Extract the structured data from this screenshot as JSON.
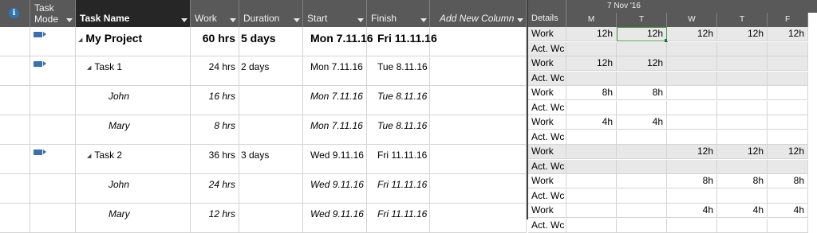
{
  "table": {
    "headers": {
      "info_icon_label": "i",
      "task_mode": "Task Mode",
      "task_name": "Task Name",
      "work": "Work",
      "duration": "Duration",
      "start": "Start",
      "finish": "Finish",
      "add_new_column": "Add New Column"
    },
    "rows": [
      {
        "name": "My Project",
        "work": "60 hrs",
        "duration": "5 days",
        "start": "Mon 7.11.16",
        "finish": "Fri 11.11.16",
        "style": "summary",
        "mode_icon": true
      },
      {
        "name": "Task 1",
        "work": "24 hrs",
        "duration": "2 days",
        "start": "Mon 7.11.16",
        "finish": "Tue 8.11.16",
        "style": "task",
        "mode_icon": true
      },
      {
        "name": "John",
        "work": "16 hrs",
        "duration": "",
        "start": "Mon 7.11.16",
        "finish": "Tue 8.11.16",
        "style": "assignment",
        "mode_icon": false
      },
      {
        "name": "Mary",
        "work": "8 hrs",
        "duration": "",
        "start": "Mon 7.11.16",
        "finish": "Tue 8.11.16",
        "style": "assignment",
        "mode_icon": false
      },
      {
        "name": "Task 2",
        "work": "36 hrs",
        "duration": "3 days",
        "start": "Wed 9.11.16",
        "finish": "Fri 11.11.16",
        "style": "task",
        "mode_icon": true
      },
      {
        "name": "John",
        "work": "24 hrs",
        "duration": "",
        "start": "Wed 9.11.16",
        "finish": "Fri 11.11.16",
        "style": "assignment",
        "mode_icon": false
      },
      {
        "name": "Mary",
        "work": "12 hrs",
        "duration": "",
        "start": "Wed 9.11.16",
        "finish": "Fri 11.11.16",
        "style": "assignment",
        "mode_icon": false
      }
    ]
  },
  "timephased": {
    "week_label": "7 Nov '16",
    "details_header": "Details",
    "days": [
      "M",
      "T",
      "W",
      "T",
      "F"
    ],
    "work_label": "Work",
    "actual_work_label": "Act. Wc",
    "rows": [
      {
        "work": [
          "12h",
          "12h",
          "12h",
          "12h",
          "12h"
        ],
        "shaded": true
      },
      {
        "work": [
          "12h",
          "12h",
          "",
          "",
          ""
        ],
        "shaded": true
      },
      {
        "work": [
          "8h",
          "8h",
          "",
          "",
          ""
        ],
        "shaded": false
      },
      {
        "work": [
          "4h",
          "4h",
          "",
          "",
          ""
        ],
        "shaded": false
      },
      {
        "work": [
          "",
          "",
          "12h",
          "12h",
          "12h"
        ],
        "shaded": true
      },
      {
        "work": [
          "",
          "",
          "8h",
          "8h",
          "8h"
        ],
        "shaded": false
      },
      {
        "work": [
          "",
          "",
          "4h",
          "4h",
          "4h"
        ],
        "shaded": false
      }
    ],
    "selected_cell": {
      "row": 0,
      "day": 1
    }
  },
  "colors": {
    "header_bg": "#595959",
    "active_header_bg": "#262626",
    "shaded_bg": "#e8e8e8",
    "mode_icon": "#3a6fb0",
    "selection": "#217346"
  }
}
